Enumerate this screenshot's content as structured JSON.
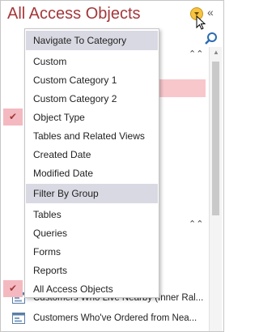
{
  "pane": {
    "title": "All Access Objects",
    "collapse_glyph": "«",
    "dropdown_icon": "chevron-down-circle-icon",
    "search_icon": "search-icon",
    "accent_color": "#a4373a"
  },
  "menu": {
    "navigate_header": "Navigate To Category",
    "categories": [
      "Custom",
      "Custom Category 1",
      "Custom Category 2",
      "Object Type",
      "Tables and Related Views",
      "Created Date",
      "Modified Date"
    ],
    "selected_category": "Object Type",
    "filter_header": "Filter By Group",
    "groups": [
      "Tables",
      "Queries",
      "Forms",
      "Reports",
      "All Access Objects"
    ],
    "selected_group": "All Access Objects",
    "check_glyph": "✔"
  },
  "background_list": {
    "items": [
      "Customers Who Live Nearby (Inner Ral...",
      "Customers Who've Ordered from Nea..."
    ]
  }
}
